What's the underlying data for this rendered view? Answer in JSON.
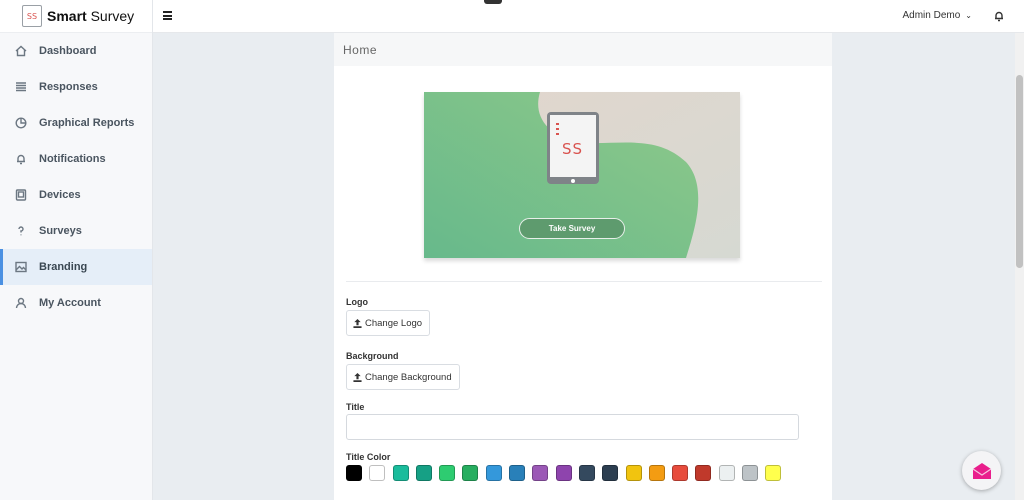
{
  "brand": {
    "logo_text": "SS",
    "name_bold": "Smart",
    "name_rest": " Survey"
  },
  "sidebar": {
    "items": [
      {
        "label": "Dashboard",
        "icon": "home-icon"
      },
      {
        "label": "Responses",
        "icon": "list-icon"
      },
      {
        "label": "Graphical Reports",
        "icon": "pie-chart-icon"
      },
      {
        "label": "Notifications",
        "icon": "bell-icon"
      },
      {
        "label": "Devices",
        "icon": "tablet-icon"
      },
      {
        "label": "Surveys",
        "icon": "question-icon"
      },
      {
        "label": "Branding",
        "icon": "image-icon",
        "active": true
      },
      {
        "label": "My Account",
        "icon": "user-icon"
      }
    ]
  },
  "topbar": {
    "user_name": "Admin Demo",
    "chevron": "⌄"
  },
  "page": {
    "header": "Home",
    "preview": {
      "tablet_text": "SS",
      "button_label": "Take Survey"
    },
    "logo": {
      "label": "Logo",
      "button_label": "Change Logo"
    },
    "background": {
      "label": "Background",
      "button_label": "Change Background"
    },
    "title": {
      "label": "Title",
      "value": "",
      "placeholder": ""
    },
    "title_color": {
      "label": "Title Color",
      "swatches": [
        "#000000",
        "#ffffff",
        "#1abc9c",
        "#16a085",
        "#2ecc71",
        "#27ae60",
        "#3498db",
        "#2980b9",
        "#9b59b6",
        "#8e44ad",
        "#34495e",
        "#2c3e50",
        "#f1c40f",
        "#f39c12",
        "#e74c3c",
        "#c0392b",
        "#ecf0f1",
        "#bdc3c7",
        "#ffff4d"
      ]
    }
  },
  "colors": {
    "accent": "#4a90e2",
    "sidebar_active_bg": "#e5eef8",
    "button_green": "#5e9b6e",
    "fab_icon": "#e91e8c"
  }
}
